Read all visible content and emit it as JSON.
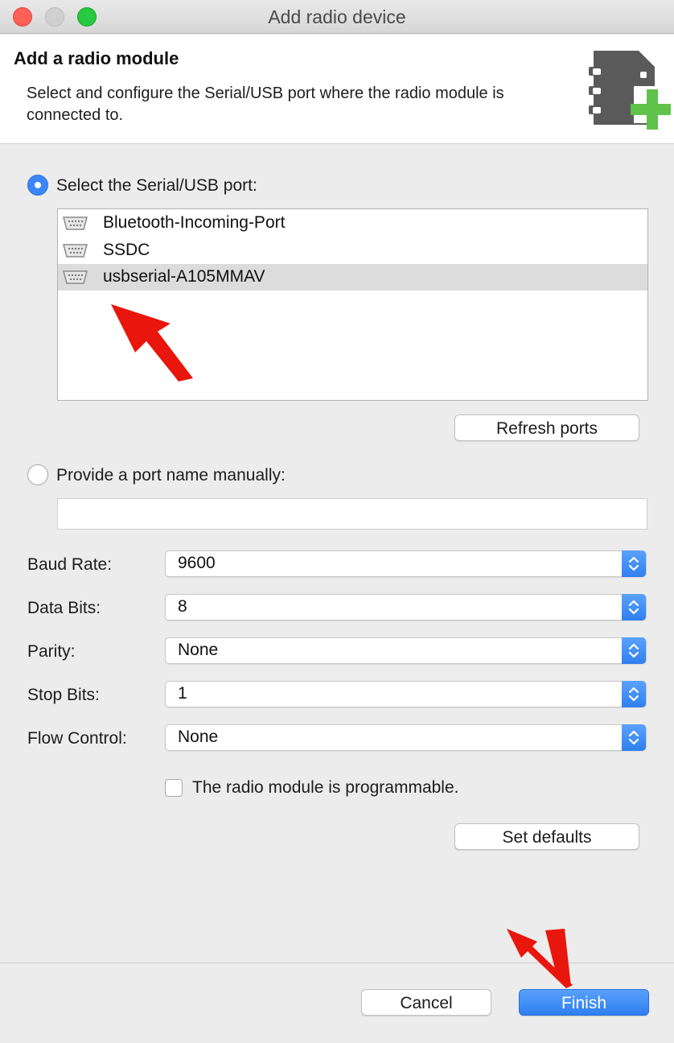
{
  "window": {
    "title": "Add radio device"
  },
  "header": {
    "title": "Add a radio module",
    "description": "Select and configure the Serial/USB port where the radio module is connected to.",
    "icon": "radio-module-add-icon"
  },
  "serial_option": {
    "label": "Select the Serial/USB port:",
    "selected": true,
    "ports": [
      {
        "name": "Bluetooth-Incoming-Port",
        "icon": "serial-port-icon",
        "selected": false
      },
      {
        "name": "SSDC",
        "icon": "serial-port-icon",
        "selected": false
      },
      {
        "name": "usbserial-A105MMAV",
        "icon": "serial-port-icon",
        "selected": true
      }
    ],
    "refresh_label": "Refresh ports"
  },
  "manual_option": {
    "label": "Provide a port name manually:",
    "selected": false,
    "value": "",
    "placeholder": ""
  },
  "settings": {
    "baud_rate": {
      "label": "Baud Rate:",
      "value": "9600"
    },
    "data_bits": {
      "label": "Data Bits:",
      "value": "8"
    },
    "parity": {
      "label": "Parity:",
      "value": "None"
    },
    "stop_bits": {
      "label": "Stop Bits:",
      "value": "1"
    },
    "flow_control": {
      "label": "Flow Control:",
      "value": "None"
    }
  },
  "programmable": {
    "label": "The radio module is programmable.",
    "checked": false
  },
  "set_defaults_label": "Set defaults",
  "footer": {
    "cancel_label": "Cancel",
    "finish_label": "Finish"
  },
  "colors": {
    "accent": "#3b86f7",
    "annotation": "#e8160c"
  }
}
